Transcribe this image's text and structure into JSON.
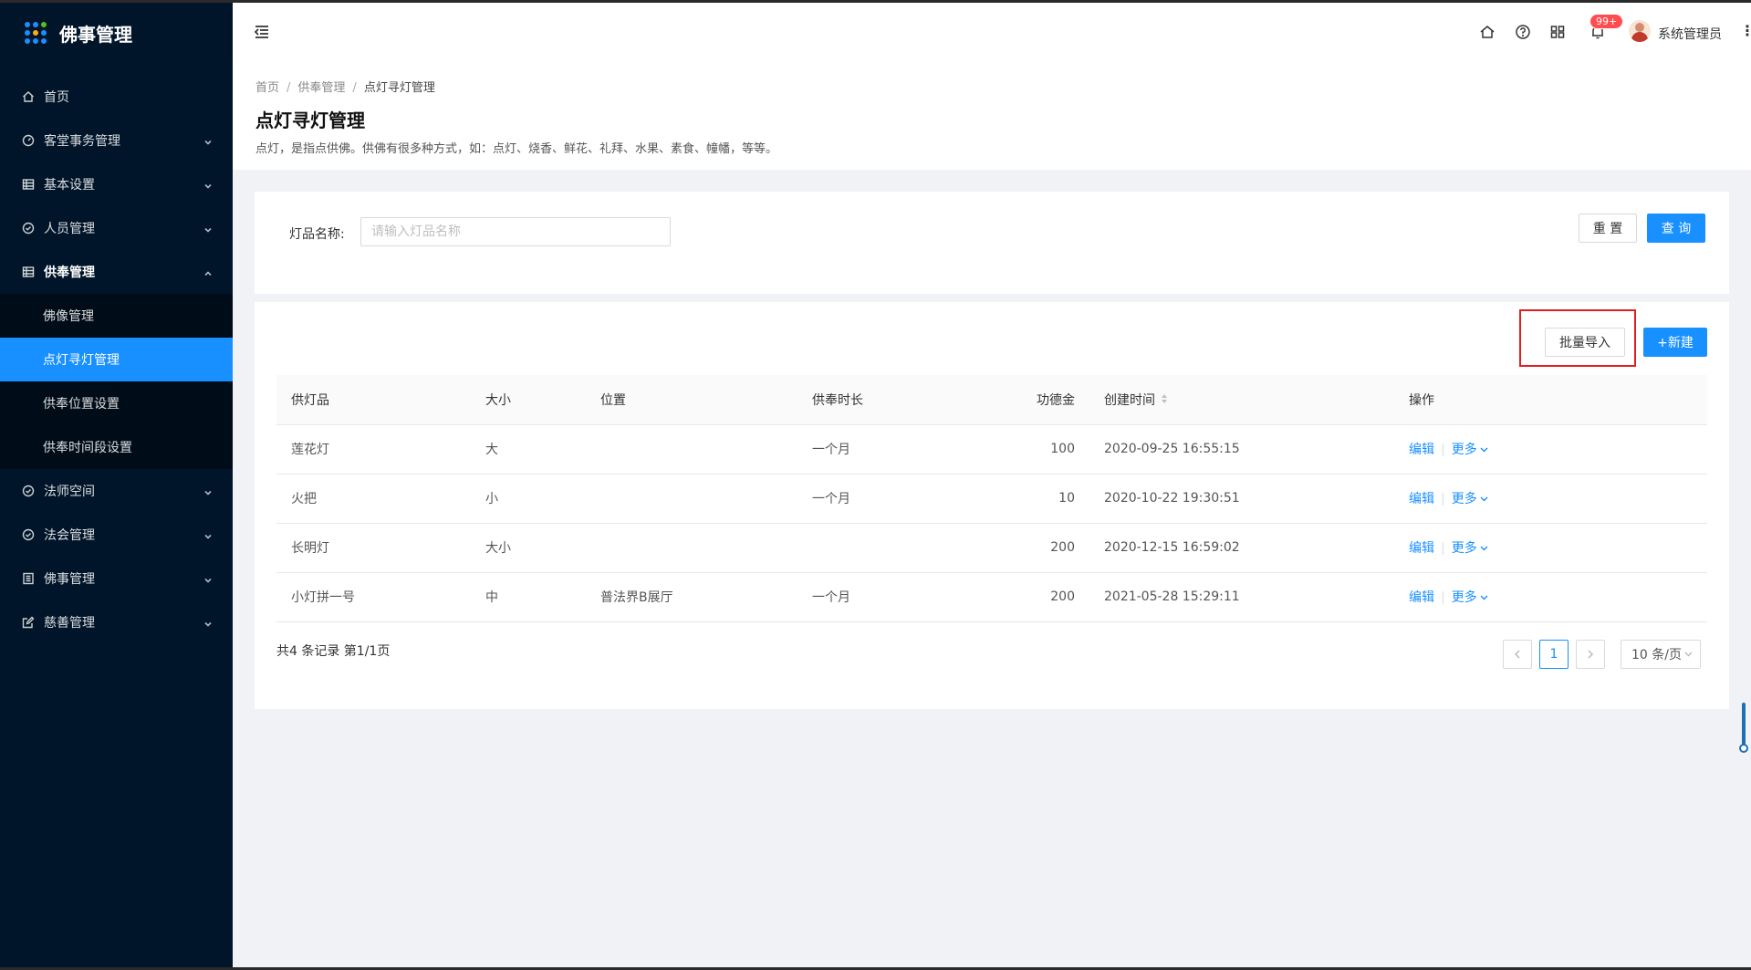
{
  "app": {
    "title": "佛事管理"
  },
  "sidebar": {
    "items": [
      {
        "label": "首页",
        "icon": "home-icon"
      },
      {
        "label": "客堂事务管理",
        "icon": "dashboard-icon"
      },
      {
        "label": "基本设置",
        "icon": "table-icon"
      },
      {
        "label": "人员管理",
        "icon": "check-circle-icon"
      },
      {
        "label": "供奉管理",
        "icon": "table-icon"
      },
      {
        "label": "法师空间",
        "icon": "check-circle-icon"
      },
      {
        "label": "法会管理",
        "icon": "check-circle-icon"
      },
      {
        "label": "佛事管理",
        "icon": "profile-icon"
      },
      {
        "label": "慈善管理",
        "icon": "form-icon"
      }
    ],
    "submenu": [
      {
        "label": "佛像管理"
      },
      {
        "label": "点灯寻灯管理",
        "active": true
      },
      {
        "label": "供奉位置设置"
      },
      {
        "label": "供奉时间段设置"
      }
    ]
  },
  "header": {
    "notification_count": "99+",
    "username": "系统管理员",
    "more": "⋮"
  },
  "breadcrumb": [
    "首页",
    "供奉管理",
    "点灯寻灯管理"
  ],
  "page": {
    "title": "点灯寻灯管理",
    "description": "点灯，是指点供佛。供佛有很多种方式，如：点灯、烧香、鲜花、礼拜、水果、素食、幢幡，等等。"
  },
  "search": {
    "label": "灯品名称:",
    "placeholder": "请输入灯品名称",
    "value": "",
    "reset_label": "重 置",
    "query_label": "查 询"
  },
  "toolbar": {
    "import_label": "批量导入",
    "new_label": "+新建"
  },
  "table": {
    "columns": [
      "供灯品",
      "大小",
      "位置",
      "供奉时长",
      "功德金",
      "创建时间",
      "操作"
    ],
    "rows": [
      {
        "name": "莲花灯",
        "size": "大",
        "location": "",
        "duration": "一个月",
        "amount": "100",
        "created": "2020-09-25 16:55:15"
      },
      {
        "name": "火把",
        "size": "小",
        "location": "",
        "duration": "一个月",
        "amount": "10",
        "created": "2020-10-22 19:30:51"
      },
      {
        "name": "长明灯",
        "size": "大小",
        "location": "",
        "duration": "",
        "amount": "200",
        "created": "2020-12-15 16:59:02"
      },
      {
        "name": "小灯拼一号",
        "size": "中",
        "location": "普法界B展厅",
        "duration": "一个月",
        "amount": "200",
        "created": "2021-05-28 15:29:11"
      }
    ],
    "edit_label": "编辑",
    "more_label": "更多"
  },
  "pagination": {
    "summary": "共4 条记录 第1/1页",
    "current_page": "1",
    "page_size": "10 条/页"
  },
  "colors": {
    "sidebar_bg": "#001529",
    "primary": "#1890ff",
    "highlight": "#e02020",
    "badge": "#ff4d4f"
  }
}
